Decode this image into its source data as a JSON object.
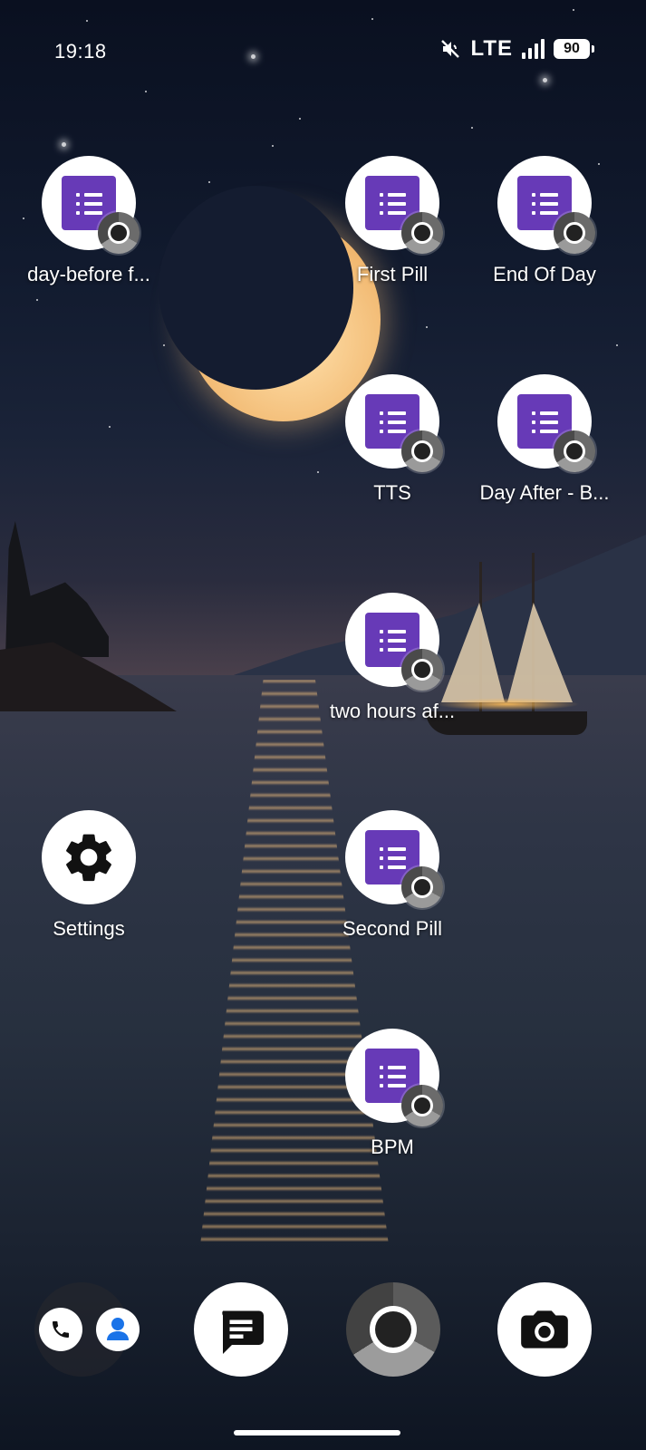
{
  "status_bar": {
    "time": "19:18",
    "network": "LTE",
    "battery": "90",
    "icons": [
      "mute-icon",
      "signal-icon",
      "battery-icon"
    ]
  },
  "apps": [
    {
      "label": "day-before f...",
      "icon": "google-forms-icon",
      "badge": "chrome-badge-icon"
    },
    {
      "label": "First Pill",
      "icon": "google-forms-icon",
      "badge": "chrome-badge-icon"
    },
    {
      "label": "End Of Day",
      "icon": "google-forms-icon",
      "badge": "chrome-badge-icon"
    },
    {
      "label": "TTS",
      "icon": "google-forms-icon",
      "badge": "chrome-badge-icon"
    },
    {
      "label": "Day After - B...",
      "icon": "google-forms-icon",
      "badge": "chrome-badge-icon"
    },
    {
      "label": "two hours af...",
      "icon": "google-forms-icon",
      "badge": "chrome-badge-icon"
    },
    {
      "label": "Settings",
      "icon": "gear-icon"
    },
    {
      "label": "Second Pill",
      "icon": "google-forms-icon",
      "badge": "chrome-badge-icon"
    },
    {
      "label": "BPM",
      "icon": "google-forms-icon",
      "badge": "chrome-badge-icon"
    }
  ],
  "dock": [
    {
      "name": "folder",
      "icons": [
        "phone-icon",
        "contacts-icon"
      ]
    },
    {
      "name": "messages",
      "icon": "message-icon"
    },
    {
      "name": "chrome",
      "icon": "chrome-icon"
    },
    {
      "name": "camera",
      "icon": "camera-icon"
    }
  ],
  "colors": {
    "forms_purple": "#673ab7",
    "contacts_blue": "#1a73e8"
  }
}
